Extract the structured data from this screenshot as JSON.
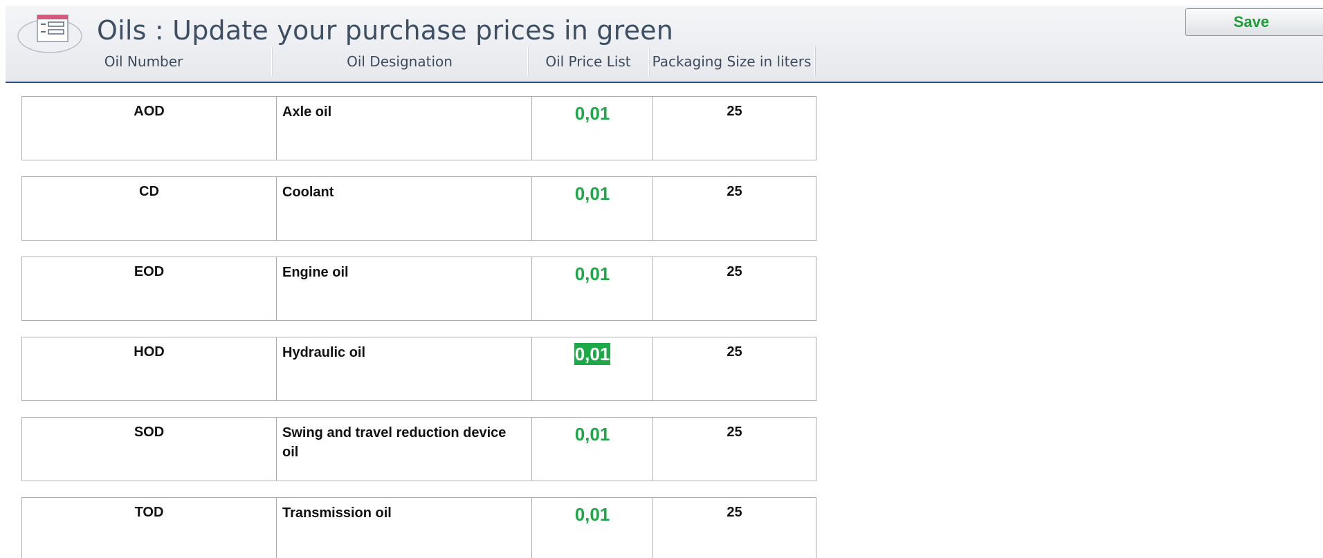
{
  "header": {
    "title": "Oils : Update your purchase prices in green",
    "save_label": "Save"
  },
  "columns": [
    "Oil Number",
    "Oil Designation",
    "Oil Price List",
    "Packaging Size in liters"
  ],
  "rows": [
    {
      "number": "AOD",
      "designation": "Axle oil",
      "price": "0,01",
      "packaging": "25"
    },
    {
      "number": "CD",
      "designation": "Coolant",
      "price": "0,01",
      "packaging": "25"
    },
    {
      "number": "EOD",
      "designation": "Engine oil",
      "price": "0,01",
      "packaging": "25"
    },
    {
      "number": "HOD",
      "designation": "Hydraulic oil",
      "price": "0,01",
      "packaging": "25",
      "selected": true
    },
    {
      "number": "SOD",
      "designation": "Swing and travel reduction device oil",
      "price": "0,01",
      "packaging": "25"
    },
    {
      "number": "TOD",
      "designation": "Transmission oil",
      "price": "0,01",
      "packaging": "25"
    }
  ],
  "colors": {
    "price_green": "#1fa848",
    "header_rule": "#2b4f7e",
    "title_text": "#3f4f63"
  },
  "icons": {
    "logo": "form-icon"
  }
}
